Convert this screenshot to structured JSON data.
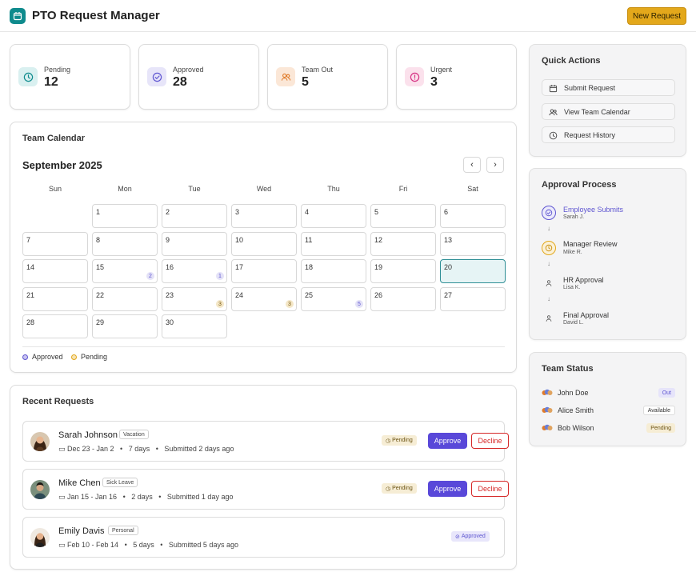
{
  "header": {
    "title": "PTO Request Manager",
    "new_request_label": "New Request"
  },
  "stats": [
    {
      "label": "Pending",
      "value": "12",
      "icon": "clock-icon",
      "color": "#0f8b8d"
    },
    {
      "label": "Approved",
      "value": "28",
      "icon": "check-circle-icon",
      "color": "#5f56d1"
    },
    {
      "label": "Team Out",
      "value": "5",
      "icon": "users-icon",
      "color": "#e07b2a"
    },
    {
      "label": "Urgent",
      "value": "3",
      "icon": "alert-circle-icon",
      "color": "#d63384"
    }
  ],
  "calendar": {
    "section_title": "Team Calendar",
    "month_label": "September 2025",
    "prev_icon": "chevron-left-icon",
    "next_icon": "chevron-right-icon",
    "prev_glyph": "‹",
    "next_glyph": "›",
    "weekdays": [
      "Sun",
      "Mon",
      "Tue",
      "Wed",
      "Thu",
      "Fri",
      "Sat"
    ],
    "first_weekday_index": 1,
    "days_in_month": 30,
    "today": 20,
    "badges": [
      {
        "day": 15,
        "count": "2",
        "status": "approved"
      },
      {
        "day": 16,
        "count": "1",
        "status": "approved"
      },
      {
        "day": 23,
        "count": "3",
        "status": "pending"
      },
      {
        "day": 24,
        "count": "3",
        "status": "pending"
      },
      {
        "day": 25,
        "count": "5",
        "status": "approved"
      }
    ],
    "legend": {
      "approved": "Approved",
      "pending": "Pending"
    },
    "colors": {
      "approved": "#5f56d1",
      "pending": "#e3a81b",
      "today_border": "#2f8f96"
    }
  },
  "recent": {
    "title": "Recent Requests",
    "items": [
      {
        "name": "Sarah Johnson",
        "type": "Vacation",
        "dates": "Dec 23 - Jan 2",
        "days": "7 days",
        "submitted": "Submitted 2 days ago",
        "status": "Pending",
        "approve": "Approve",
        "decline": "Decline"
      },
      {
        "name": "Mike Chen",
        "type": "Sick Leave",
        "dates": "Jan 15 - Jan 16",
        "days": "2 days",
        "submitted": "Submitted 1 day ago",
        "status": "Pending",
        "approve": "Approve",
        "decline": "Decline"
      },
      {
        "name": "Emily Davis",
        "type": "Personal",
        "dates": "Feb 10 - Feb 14",
        "days": "5 days",
        "submitted": "Submitted 5 days ago",
        "status": "Approved"
      }
    ]
  },
  "quick_actions": {
    "title": "Quick Actions",
    "items": [
      {
        "label": "Submit Request",
        "icon": "calendar-icon"
      },
      {
        "label": "View Team Calendar",
        "icon": "users-icon"
      },
      {
        "label": "Request History",
        "icon": "clock-icon"
      }
    ]
  },
  "approval": {
    "title": "Approval Process",
    "steps": [
      {
        "title": "Employee Submits",
        "person": "Sarah J.",
        "state": "done"
      },
      {
        "title": "Manager Review",
        "person": "Mike R.",
        "state": "current"
      },
      {
        "title": "HR Approval",
        "person": "Lisa K.",
        "state": "todo"
      },
      {
        "title": "Final Approval",
        "person": "David L.",
        "state": "todo"
      }
    ],
    "arrow": "↓"
  },
  "team_status": {
    "title": "Team Status",
    "members": [
      {
        "name": "John Doe",
        "status": "Out",
        "kind": "out"
      },
      {
        "name": "Alice Smith",
        "status": "Available",
        "kind": "available"
      },
      {
        "name": "Bob Wilson",
        "status": "Pending",
        "kind": "pending"
      }
    ]
  }
}
